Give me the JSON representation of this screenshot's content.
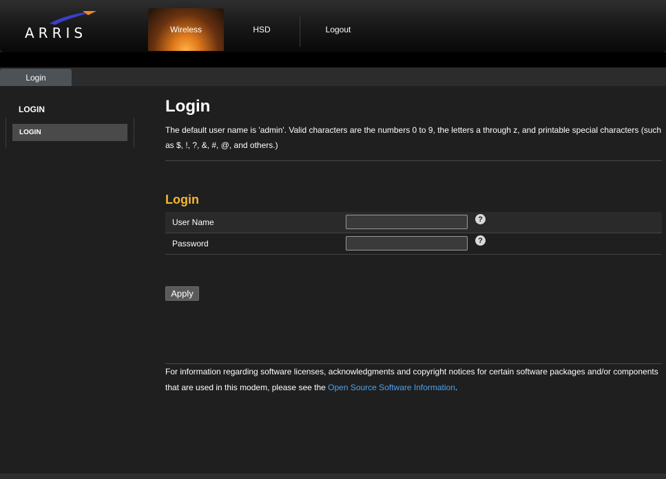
{
  "brand": {
    "logo_text": "ARRIS",
    "accent_color": "#e07a1c",
    "swoosh_colors": [
      "#3b3fc6",
      "#f08a1c"
    ]
  },
  "nav": {
    "items": [
      {
        "label": "Wireless",
        "active": true
      },
      {
        "label": "HSD",
        "active": false
      },
      {
        "label": "Logout",
        "active": false
      }
    ]
  },
  "tabs": [
    {
      "label": "Login",
      "active": true
    }
  ],
  "sidebar": {
    "title": "LOGIN",
    "items": [
      {
        "label": "LOGIN",
        "active": true
      }
    ]
  },
  "main": {
    "title": "Login",
    "description": "The default user name is 'admin'. Valid characters are the numbers 0 to 9, the letters a through z, and printable special characters (such as $, !, ?, &, #, @, and others.)",
    "section_title": "Login",
    "section_title_color": "#f5b82e",
    "fields": [
      {
        "label": "User Name",
        "value": "",
        "help_icon": "question-circle-icon"
      },
      {
        "label": "Password",
        "value": "",
        "help_icon": "question-circle-icon"
      }
    ],
    "help_glyph": "?",
    "apply_label": "Apply"
  },
  "footer": {
    "text_before": "For information regarding software licenses, acknowledgments and copyright notices for certain software packages and/or components that are used in this modem, please see the ",
    "link_text": "Open Source Software Information",
    "text_after": ".",
    "link_color": "#4aa3f0"
  }
}
